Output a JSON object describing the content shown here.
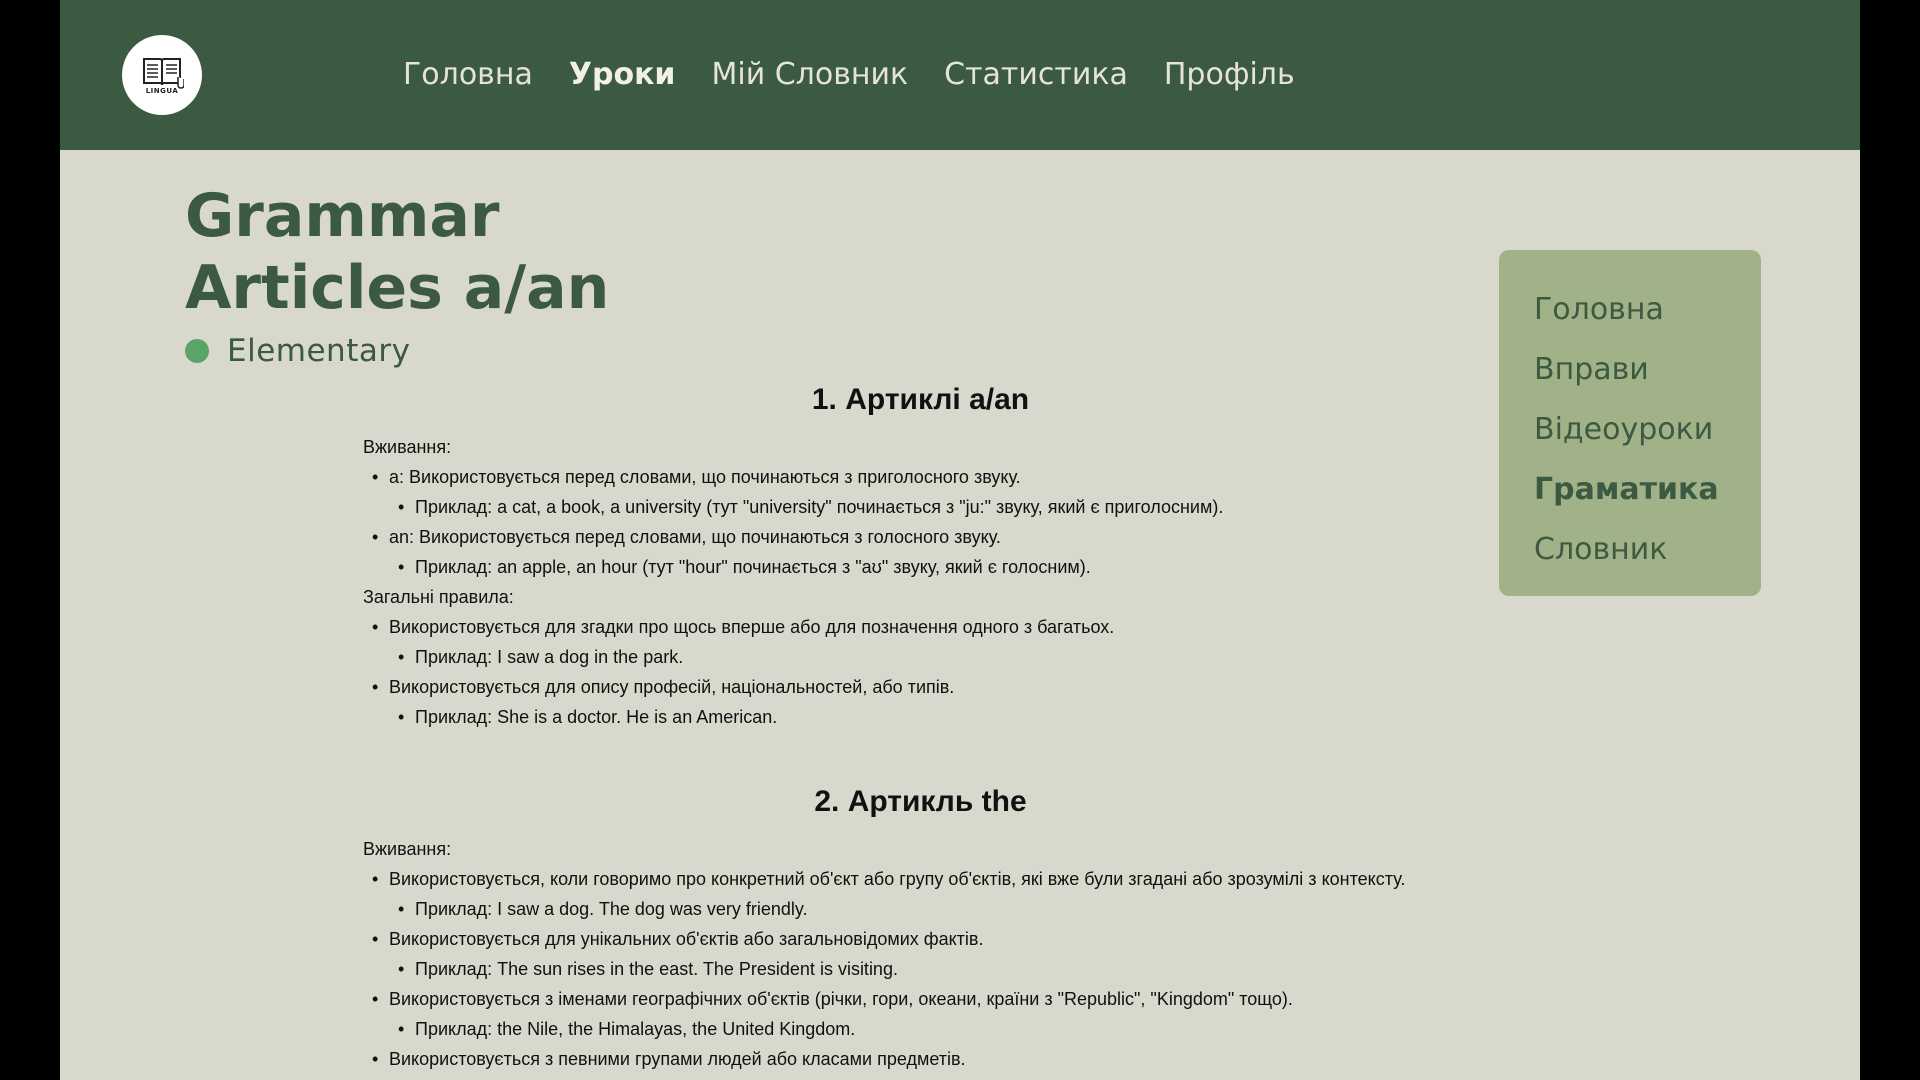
{
  "header": {
    "logo_text": "LINGUA",
    "nav": [
      {
        "label": "Головна"
      },
      {
        "label": "Уроки"
      },
      {
        "label": "Мій Словник"
      },
      {
        "label": "Статистика"
      },
      {
        "label": "Профіль"
      }
    ],
    "active_nav": "Уроки"
  },
  "page": {
    "title_line1": "Grammar",
    "title_line2": "Articles a/an",
    "level": "Elementary",
    "level_color": "#5aa46a"
  },
  "side_menu": {
    "items": [
      {
        "label": "Головна"
      },
      {
        "label": "Вправи"
      },
      {
        "label": "Відеоуроки"
      },
      {
        "label": "Граматика"
      },
      {
        "label": "Словник"
      }
    ],
    "active": "Граматика"
  },
  "sections": [
    {
      "title": "1. Артиклі a/an",
      "usage_label": "Вживання:",
      "usage": [
        {
          "text": "a: Використовується перед словами, що починаються з приголосного звуку.",
          "example": "Приклад: a cat, a book, a university (тут \"university\" починається з \"ju:\" звуку, який є приголосним)."
        },
        {
          "text": "an: Використовується перед словами, що починаються з голосного звуку.",
          "example": "Приклад: an apple, an hour (тут \"hour\" починається з \"aʊ\" звуку, який є голосним)."
        }
      ],
      "rules_label": "Загальні правила:",
      "rules": [
        {
          "text": "Використовується для згадки про щось вперше або для позначення одного з багатьох.",
          "example": "Приклад: I saw a dog in the park."
        },
        {
          "text": "Використовується для опису професій, національностей, або типів.",
          "example": "Приклад: She is a doctor. He is an American."
        }
      ]
    },
    {
      "title": "2. Артикль the",
      "usage_label": "Вживання:",
      "usage": [
        {
          "text": "Використовується, коли говоримо про конкретний об'єкт або групу об'єктів, які вже були згадані або зрозумілі з контексту.",
          "example": "Приклад: I saw a dog. The dog was very friendly."
        },
        {
          "text": "Використовується для унікальних об'єктів або загальновідомих фактів.",
          "example": "Приклад: The sun rises in the east. The President is visiting."
        },
        {
          "text": "Використовується з іменами географічних об'єктів (річки, гори, океани, країни з \"Republic\", \"Kingdom\" тощо).",
          "example": "Приклад: the Nile, the Himalayas, the United Kingdom."
        },
        {
          "text": "Використовується з певними групами людей або класами предметів.",
          "example": ""
        }
      ]
    }
  ],
  "colors": {
    "header_bg": "#3b5a41",
    "page_bg": "#d9d8cd",
    "side_menu_bg": "#a2b288",
    "accent_text": "#3b5a41"
  }
}
